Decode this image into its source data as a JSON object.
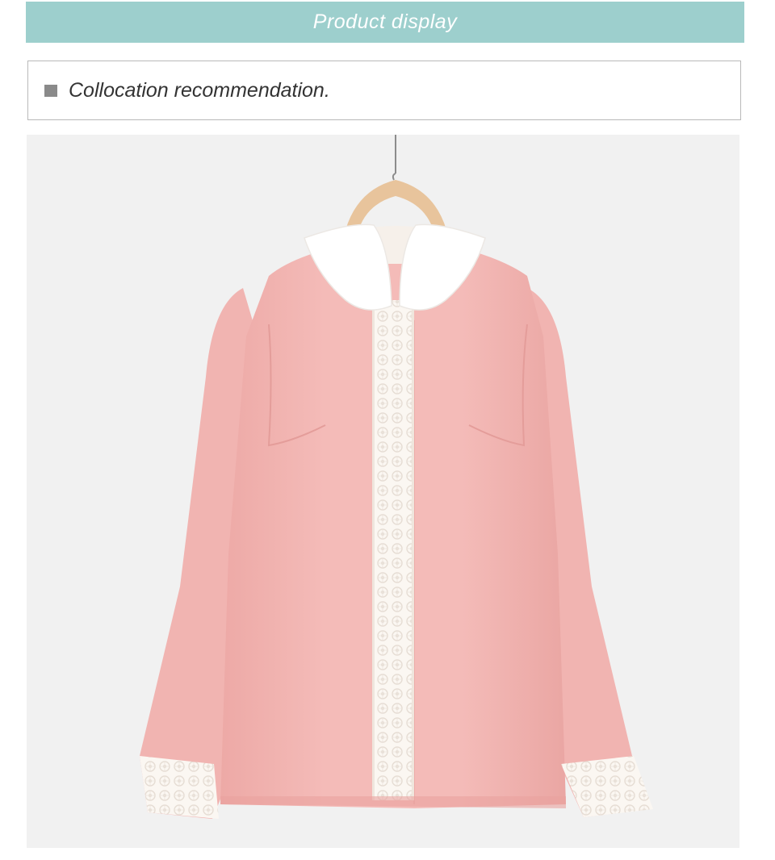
{
  "banner": {
    "title": "Product display",
    "background": "#9dcfcd"
  },
  "subheading": {
    "text": "Collocation recommendation.",
    "bullet": "square-bullet-icon"
  },
  "product_image": {
    "subject": "pink-blouse-on-hanger",
    "colors": {
      "background": "#f1f1f1",
      "fabric": "#f3b8b5",
      "fabric_shadow": "#e9a5a2",
      "collar": "#ffffff",
      "lace": "#fbf7f2",
      "hanger": "#e8c49c"
    }
  }
}
